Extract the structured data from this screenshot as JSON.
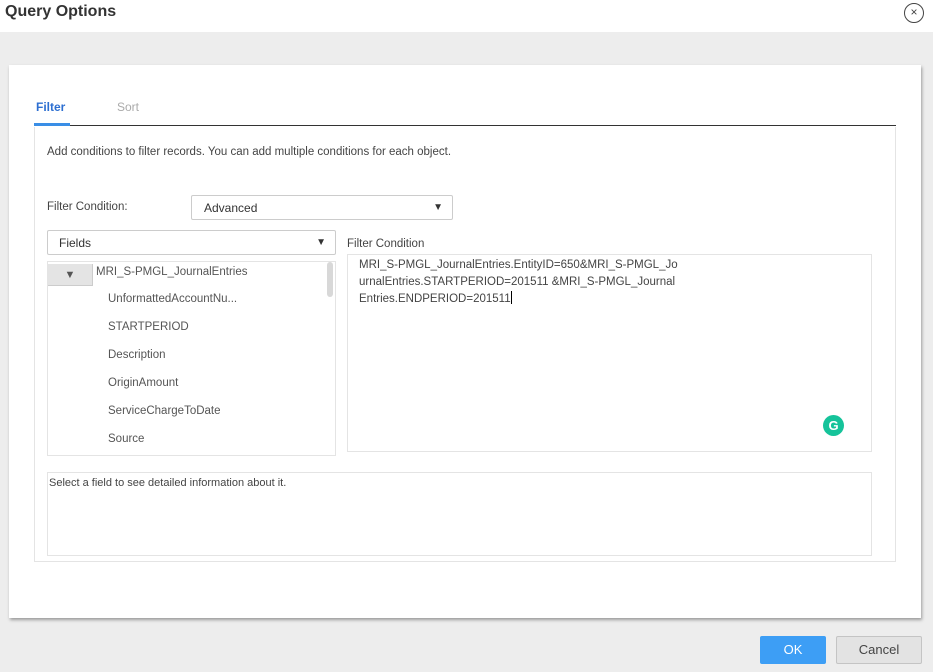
{
  "dialog": {
    "title": "Query Options",
    "close_icon": "close-circle-icon"
  },
  "tabs": [
    {
      "label": "Filter",
      "active": true
    },
    {
      "label": "Sort",
      "active": false
    }
  ],
  "filter": {
    "intro": "Add conditions to filter records. You can add multiple conditions for each object.",
    "condition_label": "Filter Condition:",
    "condition_mode": "Advanced",
    "fields_select": "Fields",
    "condition_title": "Filter Condition",
    "condition_value": "MRI_S-PMGL_JournalEntries.EntityID=650&MRI_S-PMGL_JournalEntries.STARTPERIOD=201511 &MRI_S-PMGL_JournalEntries.ENDPERIOD=201511",
    "tree": {
      "root": "MRI_S-PMGL_JournalEntries",
      "toggle_icon": "▼",
      "items": [
        "UnformattedAccountNu...",
        "STARTPERIOD",
        "Description",
        "OriginAmount",
        "ServiceChargeToDate",
        "Source"
      ]
    },
    "info_text": "Select a field to see detailed information about it.",
    "grammarly_icon": "G"
  },
  "footer": {
    "ok": "OK",
    "cancel": "Cancel"
  },
  "colors": {
    "accent": "#2d6fd1",
    "ok_button": "#3d9ef5",
    "grammarly": "#15c39a"
  }
}
